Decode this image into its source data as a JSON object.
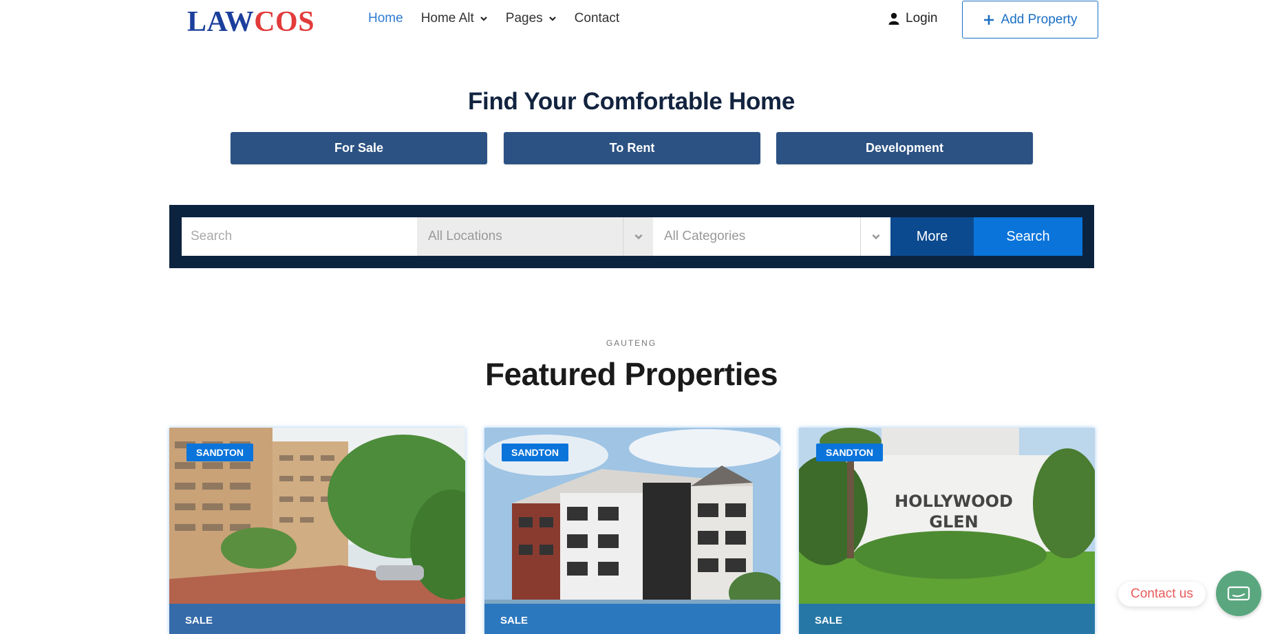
{
  "brand": {
    "logo_part1": "LAW",
    "logo_part2": "COS"
  },
  "nav": {
    "items": [
      {
        "label": "Home",
        "active": true,
        "has_dropdown": false
      },
      {
        "label": "Home Alt",
        "active": false,
        "has_dropdown": true
      },
      {
        "label": "Pages",
        "active": false,
        "has_dropdown": true
      },
      {
        "label": "Contact",
        "active": false,
        "has_dropdown": false
      }
    ],
    "login_label": "Login",
    "add_property_label": "Add Property"
  },
  "hero": {
    "title": "Find Your Comfortable Home",
    "tabs": [
      "For Sale",
      "To Rent",
      "Development"
    ]
  },
  "search": {
    "placeholder": "Search",
    "location_value": "All Locations",
    "category_value": "All Categories",
    "more_label": "More",
    "search_label": "Search"
  },
  "featured": {
    "eyebrow": "GAUTENG",
    "title": "Featured Properties",
    "cards": [
      {
        "badge": "SANDTON",
        "status": "SALE"
      },
      {
        "badge": "SANDTON",
        "status": "SALE"
      },
      {
        "badge": "SANDTON",
        "status": "SALE"
      }
    ],
    "sign_text_line1": "HOLLYWOOD",
    "sign_text_line2": "GLEN"
  },
  "contact": {
    "label": "Contact us"
  },
  "colors": {
    "primary": "#0a74db",
    "navy": "#0c2340",
    "tab_blue": "#2c5283",
    "logo_blue": "#1b3f9c",
    "logo_red": "#e23b3b",
    "contact_green": "#5aa77f"
  }
}
